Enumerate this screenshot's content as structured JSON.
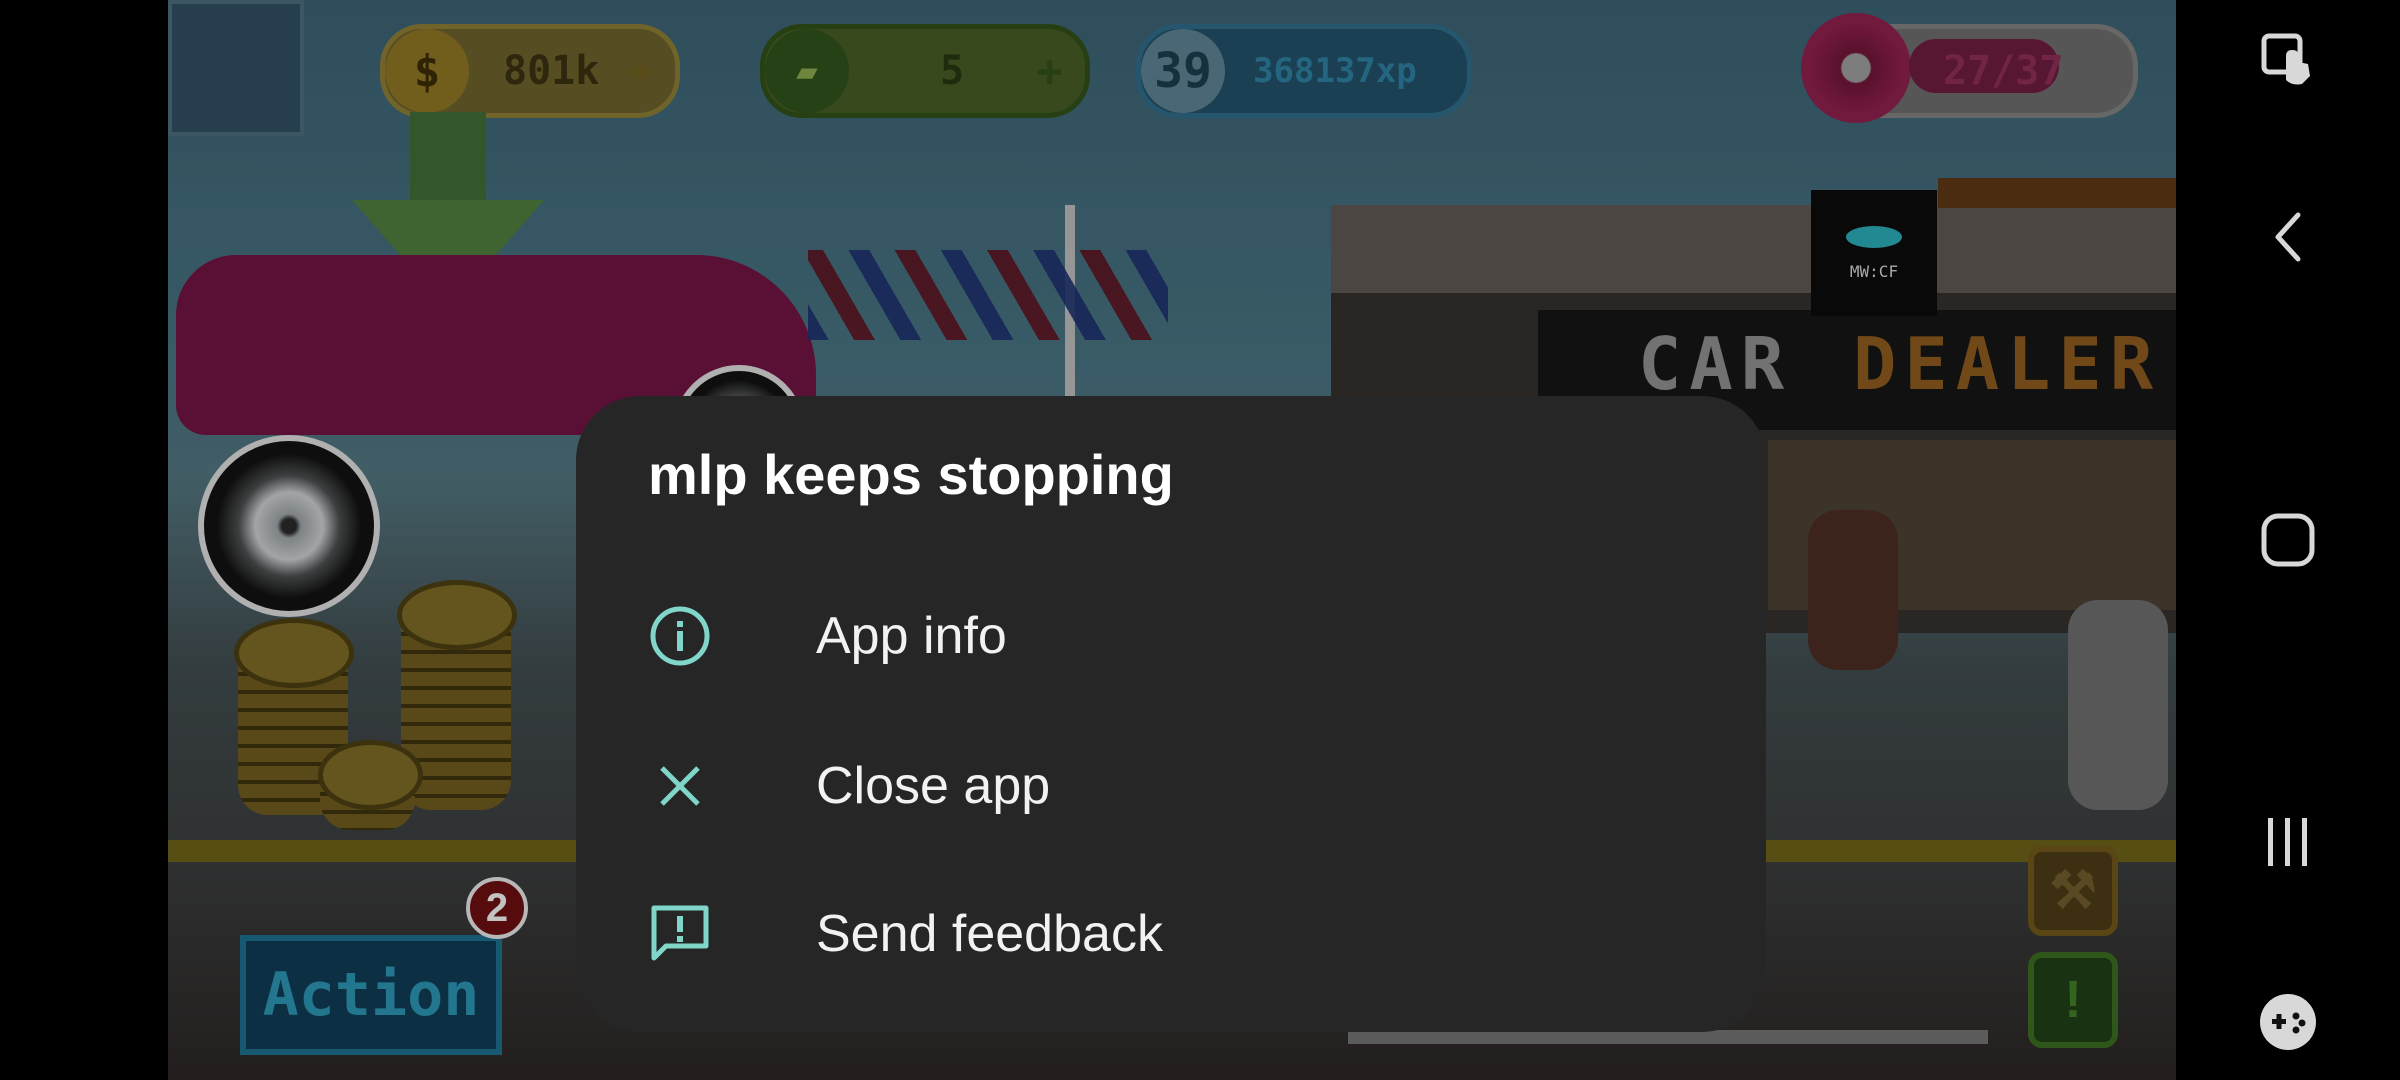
{
  "hud": {
    "coins": "801k",
    "cash": "5",
    "level": "39",
    "xp": "368137xp",
    "fuel": "27/37",
    "plus_symbol": "+",
    "coin_symbol": "$"
  },
  "game": {
    "sign_word_1": "CAR",
    "sign_word_2": "DEALER",
    "logo_text": "MW:CF",
    "action_label": "Action",
    "action_badge": "2",
    "alert_symbol": "!"
  },
  "dialog": {
    "title": "mlp keeps stopping",
    "items": [
      {
        "label": "App info",
        "icon": "info-icon"
      },
      {
        "label": "Close app",
        "icon": "close-icon"
      },
      {
        "label": "Send feedback",
        "icon": "feedback-icon"
      }
    ]
  },
  "navbar": {
    "buttons": [
      "screen-touch-icon",
      "back-icon",
      "home-icon",
      "recents-icon",
      "game-launcher-icon"
    ]
  },
  "colors": {
    "dialog_bg": "#262626",
    "accent_icon": "#7fd6c9",
    "text": "#f2f2f2"
  }
}
